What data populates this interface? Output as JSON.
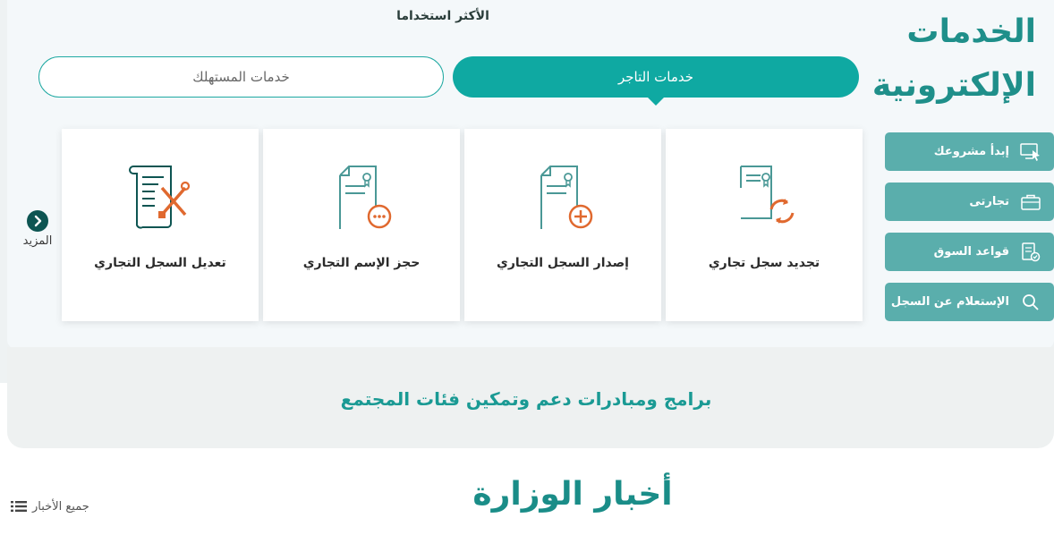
{
  "header": {
    "title_line1": "الخدمات",
    "title_line2": "الإلكترونية",
    "most_used": "الأكثر استخداما"
  },
  "tabs": {
    "merchant": "خدمات التاجر",
    "consumer": "خدمات المستهلك"
  },
  "sidebar": {
    "items": [
      {
        "label": "إبدأ مشروعك",
        "icon": "computer-cursor-icon"
      },
      {
        "label": "تجارتى",
        "icon": "briefcase-icon"
      },
      {
        "label": "قواعد السوق",
        "icon": "rules-document-icon"
      },
      {
        "label": "الإستعلام عن السجل",
        "icon": "search-icon"
      }
    ]
  },
  "cards": [
    {
      "label": "تجديد سجل تجاري",
      "icon": "renew-document-icon"
    },
    {
      "label": "إصدار السجل التجاري",
      "icon": "issue-document-icon"
    },
    {
      "label": "حجز الإسم التجاري",
      "icon": "reserve-name-icon"
    },
    {
      "label": "تعديل السجل التجاري",
      "icon": "edit-document-icon"
    }
  ],
  "more": {
    "label": "المزيد",
    "icon": "chevron-right-icon"
  },
  "programs": {
    "title": "برامج ومبادرات دعم وتمكين فئات المجتمع"
  },
  "news": {
    "title": "أخبار الوزارة",
    "all_label": "جميع الأخبار",
    "icon": "list-icon"
  },
  "colors": {
    "primary": "#0fa9a2",
    "title": "#1f8f8a",
    "sidebar": "#5aaeac",
    "accent": "#e0692f",
    "dark_teal": "#0d5552"
  }
}
